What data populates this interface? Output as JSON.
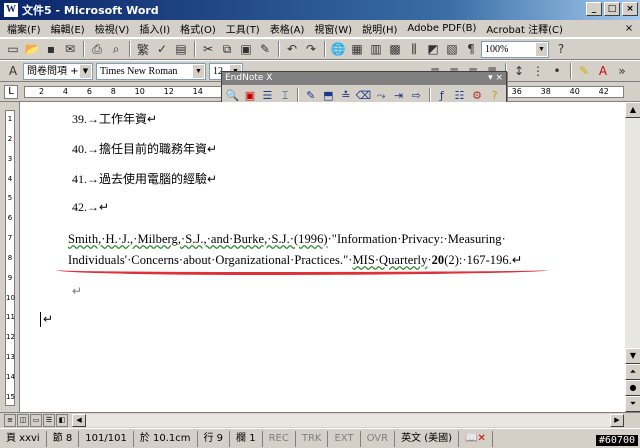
{
  "window": {
    "title": "文件5 - Microsoft Word",
    "app_icon": "W"
  },
  "menu": [
    "檔案(F)",
    "編輯(E)",
    "檢視(V)",
    "插入(I)",
    "格式(O)",
    "工具(T)",
    "表格(A)",
    "視窗(W)",
    "說明(H)",
    "Adobe PDF(B)",
    "Acrobat 注釋(C)"
  ],
  "toolbar": {
    "zoom": "100%",
    "style": "問卷問項 + 7",
    "font": "Times New Roman",
    "size": "12"
  },
  "endnote": {
    "title": "EndNote X"
  },
  "ruler": {
    "marks": [
      "2",
      "4",
      "6",
      "8",
      "10",
      "12",
      "14",
      "16",
      "18",
      "20",
      "22",
      "24",
      "26",
      "28",
      "30",
      "32",
      "34",
      "36",
      "38",
      "40",
      "42"
    ]
  },
  "vruler": {
    "marks": [
      "1",
      "2",
      "3",
      "4",
      "5",
      "6",
      "7",
      "8",
      "9",
      "10",
      "11",
      "12",
      "13",
      "14",
      "15"
    ]
  },
  "document": {
    "item39": "39.→工作年資↵",
    "item40": "40.→擔任目前的職務年資↵",
    "item41": "41.→過去使用電腦的經驗↵",
    "item42": "42.→↵",
    "ref_line1_a": "Smith,·H.·J.,·Milberg,·S.J.,·and·Burke,·S.J.·(1996)",
    "ref_line1_b": "·\"Information·Privacy:·Measuring·",
    "ref_line2_a": "Individuals'·Concerns·about·Organizational·Practices.\"·",
    "ref_line2_b": "MIS·Quarterly",
    "ref_line2_c": "·",
    "ref_line2_vol": "20",
    "ref_line2_d": "(2):·167-196.↵",
    "para_mark": "↵",
    "cursor_mark": "↵"
  },
  "status": {
    "page": "頁 xxvi",
    "section": "節 8",
    "pages": "101/101",
    "at": "於 10.1cm",
    "line": "行 9",
    "col": "欄 1",
    "rec": "REC",
    "trk": "TRK",
    "ext": "EXT",
    "ovr": "OVR",
    "lang": "英文 (美國)"
  },
  "watermark": "#60700"
}
